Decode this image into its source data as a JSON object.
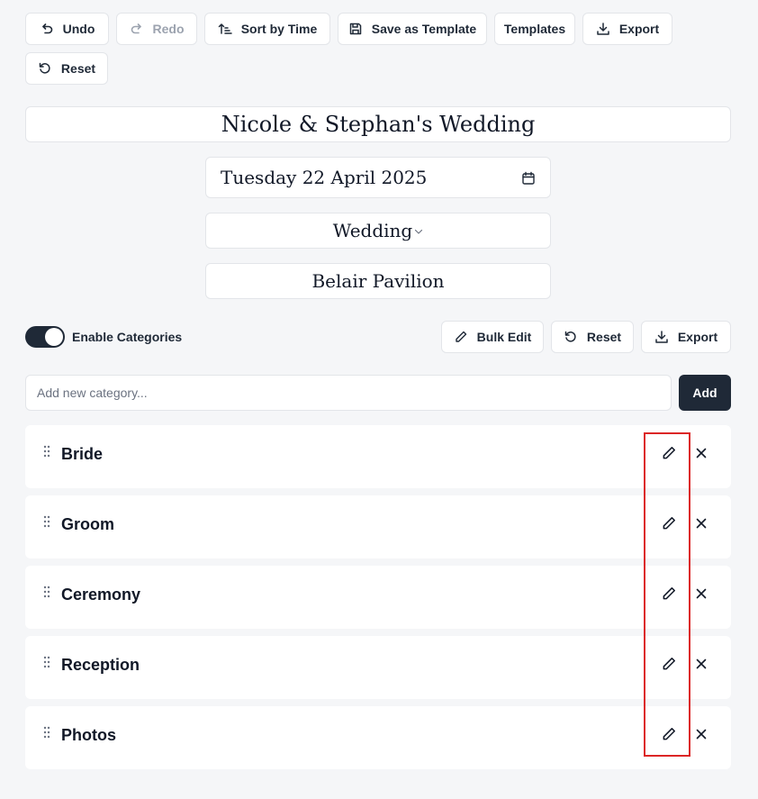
{
  "toolbar": {
    "undo": "Undo",
    "redo": "Redo",
    "sort_by_time": "Sort by Time",
    "save_as_template": "Save as Template",
    "templates": "Templates",
    "export": "Export",
    "reset": "Reset"
  },
  "event": {
    "title": "Nicole & Stephan's Wedding",
    "date": "Tuesday 22 April 2025",
    "type": "Wedding",
    "venue": "Belair Pavilion"
  },
  "categories_bar": {
    "toggle_label": "Enable Categories",
    "toggle_on": true,
    "bulk_edit": "Bulk Edit",
    "reset": "Reset",
    "export": "Export"
  },
  "add_category": {
    "placeholder": "Add new category...",
    "button": "Add"
  },
  "categories": [
    {
      "name": "Bride"
    },
    {
      "name": "Groom"
    },
    {
      "name": "Ceremony"
    },
    {
      "name": "Reception"
    },
    {
      "name": "Photos"
    }
  ],
  "colors": {
    "accent": "#1f2937",
    "highlight": "#dc2626",
    "background": "#f5f6f8"
  }
}
